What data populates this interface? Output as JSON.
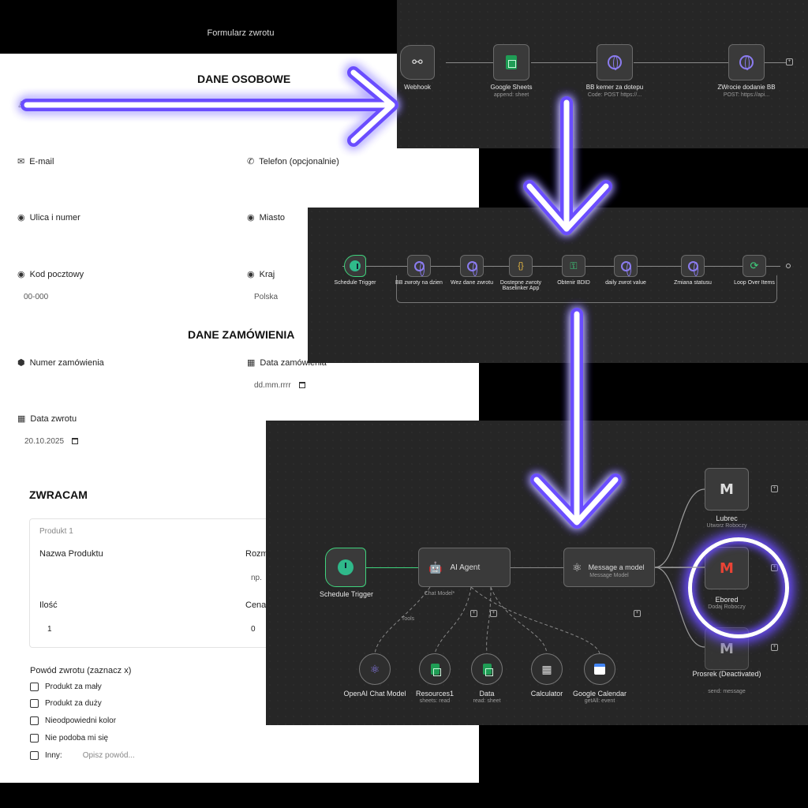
{
  "window": {
    "title": "Formularz zwrotu"
  },
  "form": {
    "personal_title": "DANE OSOBOWE",
    "email_label": "E-mail",
    "phone_label": "Telefon (opcjonalnie)",
    "street_label": "Ulica i numer",
    "city_label": "Miasto",
    "postcode_label": "Kod pocztowy",
    "postcode_value": "00-000",
    "country_label": "Kraj",
    "country_value": "Polska",
    "order_title": "DANE ZAMÓWIENIA",
    "order_number_label": "Numer zamówienia",
    "order_date_label": "Data zamówienia",
    "order_date_value": "dd.mm.rrrr",
    "return_date_label": "Data zwrotu",
    "return_date_value": "20.10.2025",
    "returning_title": "ZWRACAM",
    "product_header": "Produkt 1",
    "product_name_label": "Nazwa Produktu",
    "size_label": "Rozm",
    "size_value": "np.",
    "qty_label": "Ilość",
    "qty_value": "1",
    "price_label": "Cena",
    "price_value": "0",
    "reason_title": "Powód zwrotu (zaznacz x)",
    "reasons": [
      "Produkt za mały",
      "Produkt za duży",
      "Nieodpowiedni kolor",
      "Nie podoba mi się",
      "Inny:"
    ],
    "other_placeholder": "Opisz powód..."
  },
  "workflow1": {
    "nodes": [
      {
        "label": "Webhook",
        "sub": ""
      },
      {
        "label": "Google Sheets",
        "sub": "append: sheet"
      },
      {
        "label": "BB kemer za dotepu",
        "sub": "Code: POST https://..."
      },
      {
        "label": "ZWrocie dodanie BB",
        "sub": "POST: https://api..."
      }
    ]
  },
  "workflow2": {
    "nodes": [
      {
        "label": "Schedule Trigger"
      },
      {
        "label": "BB zwroty na dzien"
      },
      {
        "label": "Wez dane zwrotu"
      },
      {
        "label": "Dostepne zwroty Baselinker App"
      },
      {
        "label": "Obtenir BDID"
      },
      {
        "label": "daily zwrot value"
      },
      {
        "label": "Zmiana statusu"
      },
      {
        "label": "Loop Over Items"
      }
    ]
  },
  "workflow3": {
    "trigger": "Schedule Trigger",
    "agent": "AI Agent",
    "agent_sub": "Chat Model*",
    "message": {
      "label": "Message a model",
      "sub": "Message Model"
    },
    "tools_label": "Tools",
    "tools": [
      {
        "label": "OpenAI Chat Model",
        "sub": ""
      },
      {
        "label": "Resources1",
        "sub": "sheets: read"
      },
      {
        "label": "Data",
        "sub": "read: sheet"
      },
      {
        "label": "Calculator",
        "sub": ""
      },
      {
        "label": "Google Calendar",
        "sub": "getAll: event"
      }
    ],
    "gmail_nodes": [
      {
        "label": "Lubrec",
        "sub": "Utworz Roboczy"
      },
      {
        "label": "Ebored",
        "sub": "Dodaj Roboczy"
      },
      {
        "label": "Prosrek (Deactivated)",
        "sub": "send: message"
      }
    ]
  },
  "colors": {
    "glow": "#6b4dff",
    "accent_green": "#3fd37d",
    "gmail_red": "#ea4335"
  }
}
